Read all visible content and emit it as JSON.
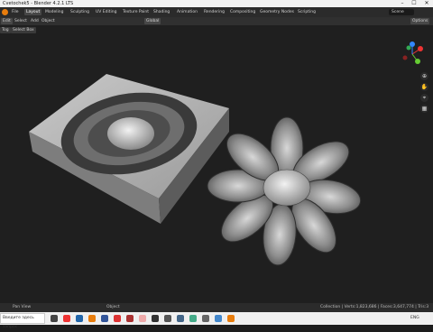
{
  "window": {
    "title": "Cvetochek5 - Blender 4.2.1 LTS",
    "minimize": "–",
    "maximize": "☐",
    "close": "✕"
  },
  "menu": {
    "items": [
      "File",
      "Layout",
      "Modeling",
      "Sculpting",
      "UV Editing",
      "Texture Paint",
      "Shading",
      "Animation",
      "Rendering",
      "Compositing",
      "Geometry Nodes",
      "Scripting"
    ],
    "active": "Layout",
    "scene": "Scene"
  },
  "toolbar": {
    "mode_items": [
      "Edit",
      "Select",
      "Add",
      "Object"
    ],
    "transform": "Global",
    "options": "Options"
  },
  "viewport": {
    "left_items": [
      "Tog",
      "Select Box"
    ]
  },
  "gizmo": {
    "x": "X",
    "y": "Y",
    "z": "Z"
  },
  "status": {
    "left": "Pan View",
    "mid": "Object",
    "right": "Collection | Verts:1,823,686 | Faces:3,647,774 | Tris:3"
  },
  "taskbar": {
    "search_placeholder": "Введите здесь запрос",
    "time": "ENG"
  },
  "colors": {
    "accent": "#e87d0d",
    "active_tab": "#474747",
    "viewport_bg": "#1f1f1f"
  }
}
